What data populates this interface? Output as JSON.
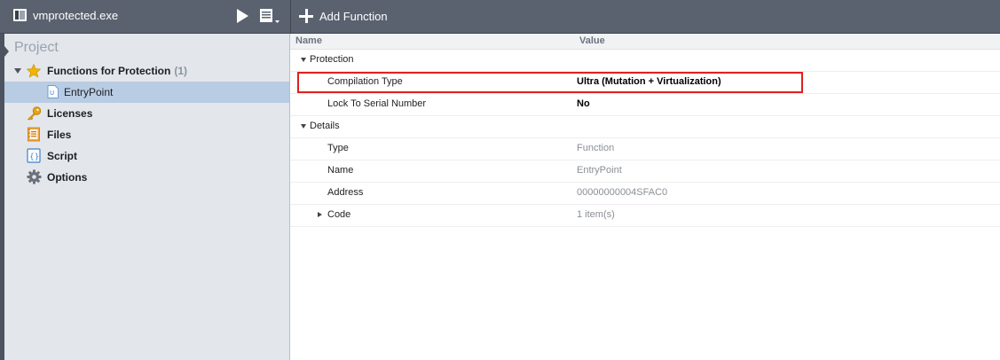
{
  "toolbar": {
    "file_name": "vmprotected.exe",
    "add_function_label": "Add Function",
    "play_icon": "play-icon",
    "compile_icon": "compile-options-icon"
  },
  "sidebar": {
    "title": "Project",
    "items": [
      {
        "label": "Functions for Protection",
        "count": "(1)",
        "icon": "star-icon",
        "expanded": true
      },
      {
        "label": "EntryPoint",
        "icon": "function-icon",
        "selected": true
      },
      {
        "label": "Licenses",
        "icon": "key-icon"
      },
      {
        "label": "Files",
        "icon": "files-icon"
      },
      {
        "label": "Script",
        "icon": "script-icon"
      },
      {
        "label": "Options",
        "icon": "gear-icon"
      }
    ]
  },
  "grid": {
    "headers": {
      "name": "Name",
      "value": "Value"
    },
    "groups": [
      {
        "label": "Protection",
        "rows": [
          {
            "name": "Compilation Type",
            "value": "Ultra (Mutation + Virtualization)"
          },
          {
            "name": "Lock To Serial Number",
            "value": "No"
          }
        ]
      },
      {
        "label": "Details",
        "rows": [
          {
            "name": "Type",
            "value": "Function"
          },
          {
            "name": "Name",
            "value": "EntryPoint"
          },
          {
            "name": "Address",
            "value": "00000000004SFAC0"
          },
          {
            "name": "Code",
            "value": "1 item(s)"
          }
        ]
      }
    ]
  },
  "colors": {
    "toolbar_bg": "#5a6270",
    "sidebar_bg": "#e3e7ec",
    "selection": "#b8cce3",
    "highlight_border": "#e02020",
    "star": "#f0b400"
  }
}
